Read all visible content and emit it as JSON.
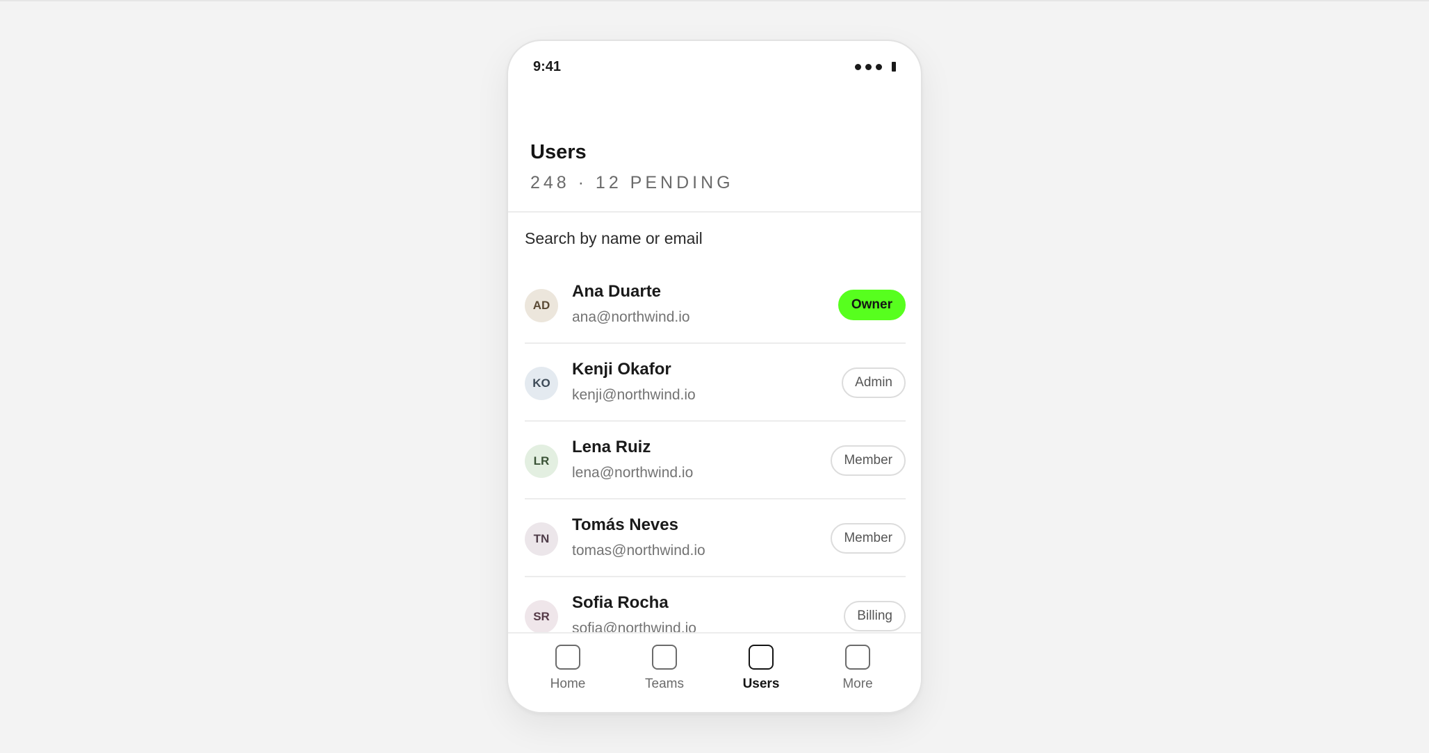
{
  "status": {
    "time": "9:41"
  },
  "header": {
    "title": "Users",
    "subtitle": "248 · 12 PENDING"
  },
  "search": {
    "placeholder": "Search by name or email"
  },
  "users": [
    {
      "initials": "AD",
      "name": "Ana Duarte",
      "email": "ana@northwind.io",
      "role": "Owner",
      "avatar_bg": "#ece6dc",
      "avatar_fg": "#5a4a35",
      "primary": true
    },
    {
      "initials": "KO",
      "name": "Kenji Okafor",
      "email": "kenji@northwind.io",
      "role": "Admin",
      "avatar_bg": "#e4eaf0",
      "avatar_fg": "#3d4a57",
      "primary": false
    },
    {
      "initials": "LR",
      "name": "Lena Ruiz",
      "email": "lena@northwind.io",
      "role": "Member",
      "avatar_bg": "#e3efe1",
      "avatar_fg": "#3a5236",
      "primary": false
    },
    {
      "initials": "TN",
      "name": "Tomás Neves",
      "email": "tomas@northwind.io",
      "role": "Member",
      "avatar_bg": "#ece6ea",
      "avatar_fg": "#4f3d49",
      "primary": false
    },
    {
      "initials": "SR",
      "name": "Sofia Rocha",
      "email": "sofia@northwind.io",
      "role": "Billing",
      "avatar_bg": "#efe6ea",
      "avatar_fg": "#553a47",
      "primary": false
    }
  ],
  "tabs": [
    {
      "label": "Home",
      "icon": "home-icon",
      "active": false
    },
    {
      "label": "Teams",
      "icon": "teams-icon",
      "active": false
    },
    {
      "label": "Users",
      "icon": "users-icon",
      "active": true
    },
    {
      "label": "More",
      "icon": "more-icon",
      "active": false
    }
  ],
  "colors": {
    "accent": "#57ff1e",
    "background": "#f3f3f3",
    "surface": "#ffffff"
  }
}
